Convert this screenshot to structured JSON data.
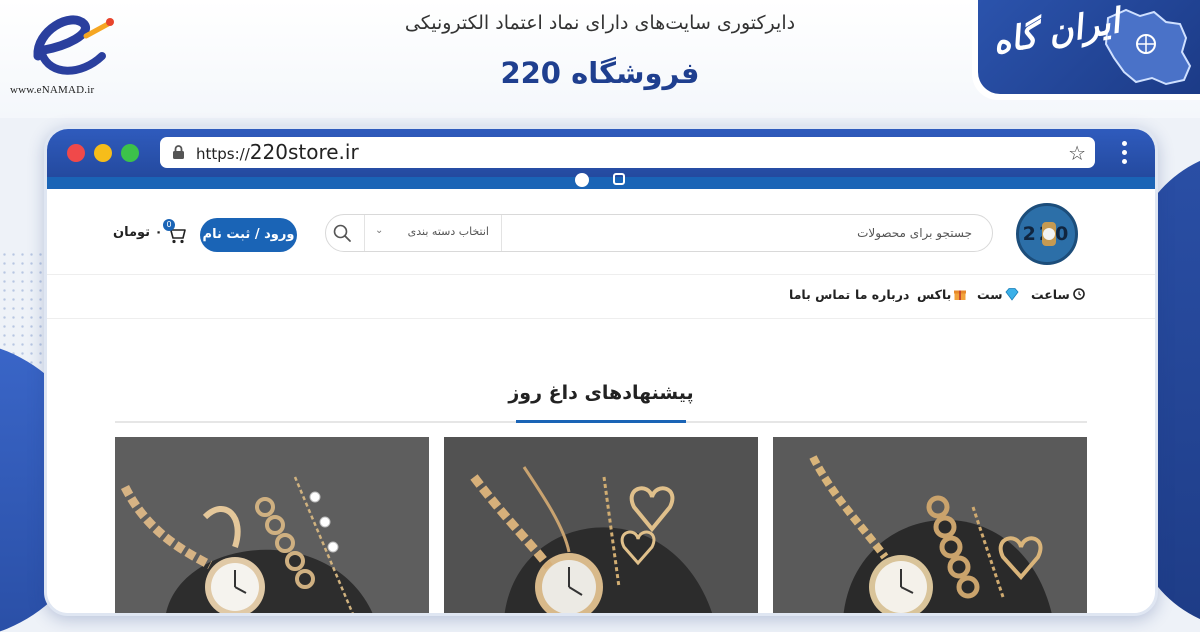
{
  "header": {
    "directory_title": "دایرکتوری سایت‌های دارای نماد اعتماد الکترونیکی",
    "store_name": "فروشگاه 220",
    "enamad_url": "www.eNAMAD.ir",
    "badge_text": "ایران گاه"
  },
  "browser": {
    "url_protocol": "https://",
    "url_domain": "220store.ir"
  },
  "site": {
    "logo_text": "220",
    "search": {
      "placeholder": "جستجو برای محصولات",
      "category_placeholder": "انتخاب دسته بندی"
    },
    "login_label": "ورود / ثبت نام",
    "cart": {
      "count": "0",
      "price": "۰ تومان"
    },
    "nav": [
      {
        "label": "ساعت",
        "icon": "watch-icon"
      },
      {
        "label": "ست",
        "icon": "diamond-icon"
      },
      {
        "label": "باکس",
        "icon": "gift-icon"
      },
      {
        "label": "درباره ما"
      },
      {
        "label": "تماس باما"
      }
    ],
    "section_title": "پیشنهادهای داغ روز",
    "products": [
      {
        "image": "rose-gold-watch-bracelet-set"
      },
      {
        "image": "gold-heart-watch-set"
      },
      {
        "image": "gold-chain-watch-set"
      }
    ]
  },
  "colors": {
    "primary": "#1a64b6",
    "browser_chrome": "#2f5bbd",
    "title_blue": "#1f3f8f"
  }
}
